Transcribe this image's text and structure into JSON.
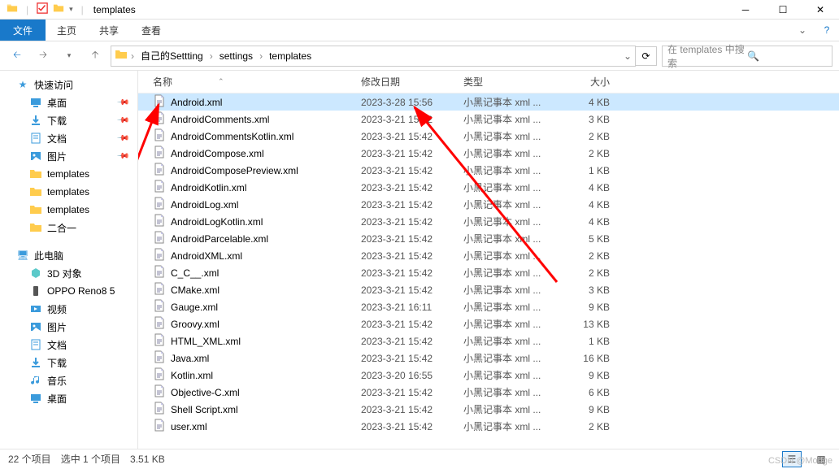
{
  "window": {
    "title": "templates"
  },
  "ribbon": {
    "file": "文件",
    "tabs": [
      "主页",
      "共享",
      "查看"
    ]
  },
  "breadcrumb": [
    "自己的Settting",
    "settings",
    "templates"
  ],
  "search": {
    "placeholder": "在 templates 中搜索"
  },
  "nav": {
    "quick": {
      "label": "快速访问",
      "items": [
        {
          "label": "桌面",
          "icon": "desktop",
          "pinned": true
        },
        {
          "label": "下载",
          "icon": "download",
          "pinned": true
        },
        {
          "label": "文档",
          "icon": "doc",
          "pinned": true
        },
        {
          "label": "图片",
          "icon": "pic",
          "pinned": true
        },
        {
          "label": "templates",
          "icon": "folder",
          "pinned": false
        },
        {
          "label": "templates",
          "icon": "folder",
          "pinned": false
        },
        {
          "label": "templates",
          "icon": "folder",
          "pinned": false
        },
        {
          "label": "二合一",
          "icon": "folder",
          "pinned": false
        }
      ]
    },
    "pc": {
      "label": "此电脑",
      "items": [
        {
          "label": "3D 对象",
          "icon": "3d"
        },
        {
          "label": "OPPO Reno8 5",
          "icon": "phone"
        },
        {
          "label": "视频",
          "icon": "video"
        },
        {
          "label": "图片",
          "icon": "pic"
        },
        {
          "label": "文档",
          "icon": "doc"
        },
        {
          "label": "下载",
          "icon": "download"
        },
        {
          "label": "音乐",
          "icon": "music"
        },
        {
          "label": "桌面",
          "icon": "desktop"
        }
      ]
    }
  },
  "columns": {
    "name": "名称",
    "date": "修改日期",
    "type": "类型",
    "size": "大小"
  },
  "files": [
    {
      "name": "Android.xml",
      "date": "2023-3-28 15:56",
      "type": "小黑记事本 xml ...",
      "size": "4 KB",
      "selected": true
    },
    {
      "name": "AndroidComments.xml",
      "date": "2023-3-21 15:42",
      "type": "小黑记事本 xml ...",
      "size": "3 KB"
    },
    {
      "name": "AndroidCommentsKotlin.xml",
      "date": "2023-3-21 15:42",
      "type": "小黑记事本 xml ...",
      "size": "2 KB"
    },
    {
      "name": "AndroidCompose.xml",
      "date": "2023-3-21 15:42",
      "type": "小黑记事本 xml ...",
      "size": "2 KB"
    },
    {
      "name": "AndroidComposePreview.xml",
      "date": "2023-3-21 15:42",
      "type": "小黑记事本 xml ...",
      "size": "1 KB"
    },
    {
      "name": "AndroidKotlin.xml",
      "date": "2023-3-21 15:42",
      "type": "小黑记事本 xml ...",
      "size": "4 KB"
    },
    {
      "name": "AndroidLog.xml",
      "date": "2023-3-21 15:42",
      "type": "小黑记事本 xml ...",
      "size": "4 KB"
    },
    {
      "name": "AndroidLogKotlin.xml",
      "date": "2023-3-21 15:42",
      "type": "小黑记事本 xml ...",
      "size": "4 KB"
    },
    {
      "name": "AndroidParcelable.xml",
      "date": "2023-3-21 15:42",
      "type": "小黑记事本 xml ...",
      "size": "5 KB"
    },
    {
      "name": "AndroidXML.xml",
      "date": "2023-3-21 15:42",
      "type": "小黑记事本 xml ...",
      "size": "2 KB"
    },
    {
      "name": "C_C__.xml",
      "date": "2023-3-21 15:42",
      "type": "小黑记事本 xml ...",
      "size": "2 KB"
    },
    {
      "name": "CMake.xml",
      "date": "2023-3-21 15:42",
      "type": "小黑记事本 xml ...",
      "size": "3 KB"
    },
    {
      "name": "Gauge.xml",
      "date": "2023-3-21 16:11",
      "type": "小黑记事本 xml ...",
      "size": "9 KB"
    },
    {
      "name": "Groovy.xml",
      "date": "2023-3-21 15:42",
      "type": "小黑记事本 xml ...",
      "size": "13 KB"
    },
    {
      "name": "HTML_XML.xml",
      "date": "2023-3-21 15:42",
      "type": "小黑记事本 xml ...",
      "size": "1 KB"
    },
    {
      "name": "Java.xml",
      "date": "2023-3-21 15:42",
      "type": "小黑记事本 xml ...",
      "size": "16 KB"
    },
    {
      "name": "Kotlin.xml",
      "date": "2023-3-20 16:55",
      "type": "小黑记事本 xml ...",
      "size": "9 KB"
    },
    {
      "name": "Objective-C.xml",
      "date": "2023-3-21 15:42",
      "type": "小黑记事本 xml ...",
      "size": "6 KB"
    },
    {
      "name": "Shell Script.xml",
      "date": "2023-3-21 15:42",
      "type": "小黑记事本 xml ...",
      "size": "9 KB"
    },
    {
      "name": "user.xml",
      "date": "2023-3-21 15:42",
      "type": "小黑记事本 xml ...",
      "size": "2 KB"
    }
  ],
  "status": {
    "count": "22 个项目",
    "selected": "选中 1 个项目",
    "size": "3.51 KB"
  },
  "watermark": "CSDN @Modge"
}
